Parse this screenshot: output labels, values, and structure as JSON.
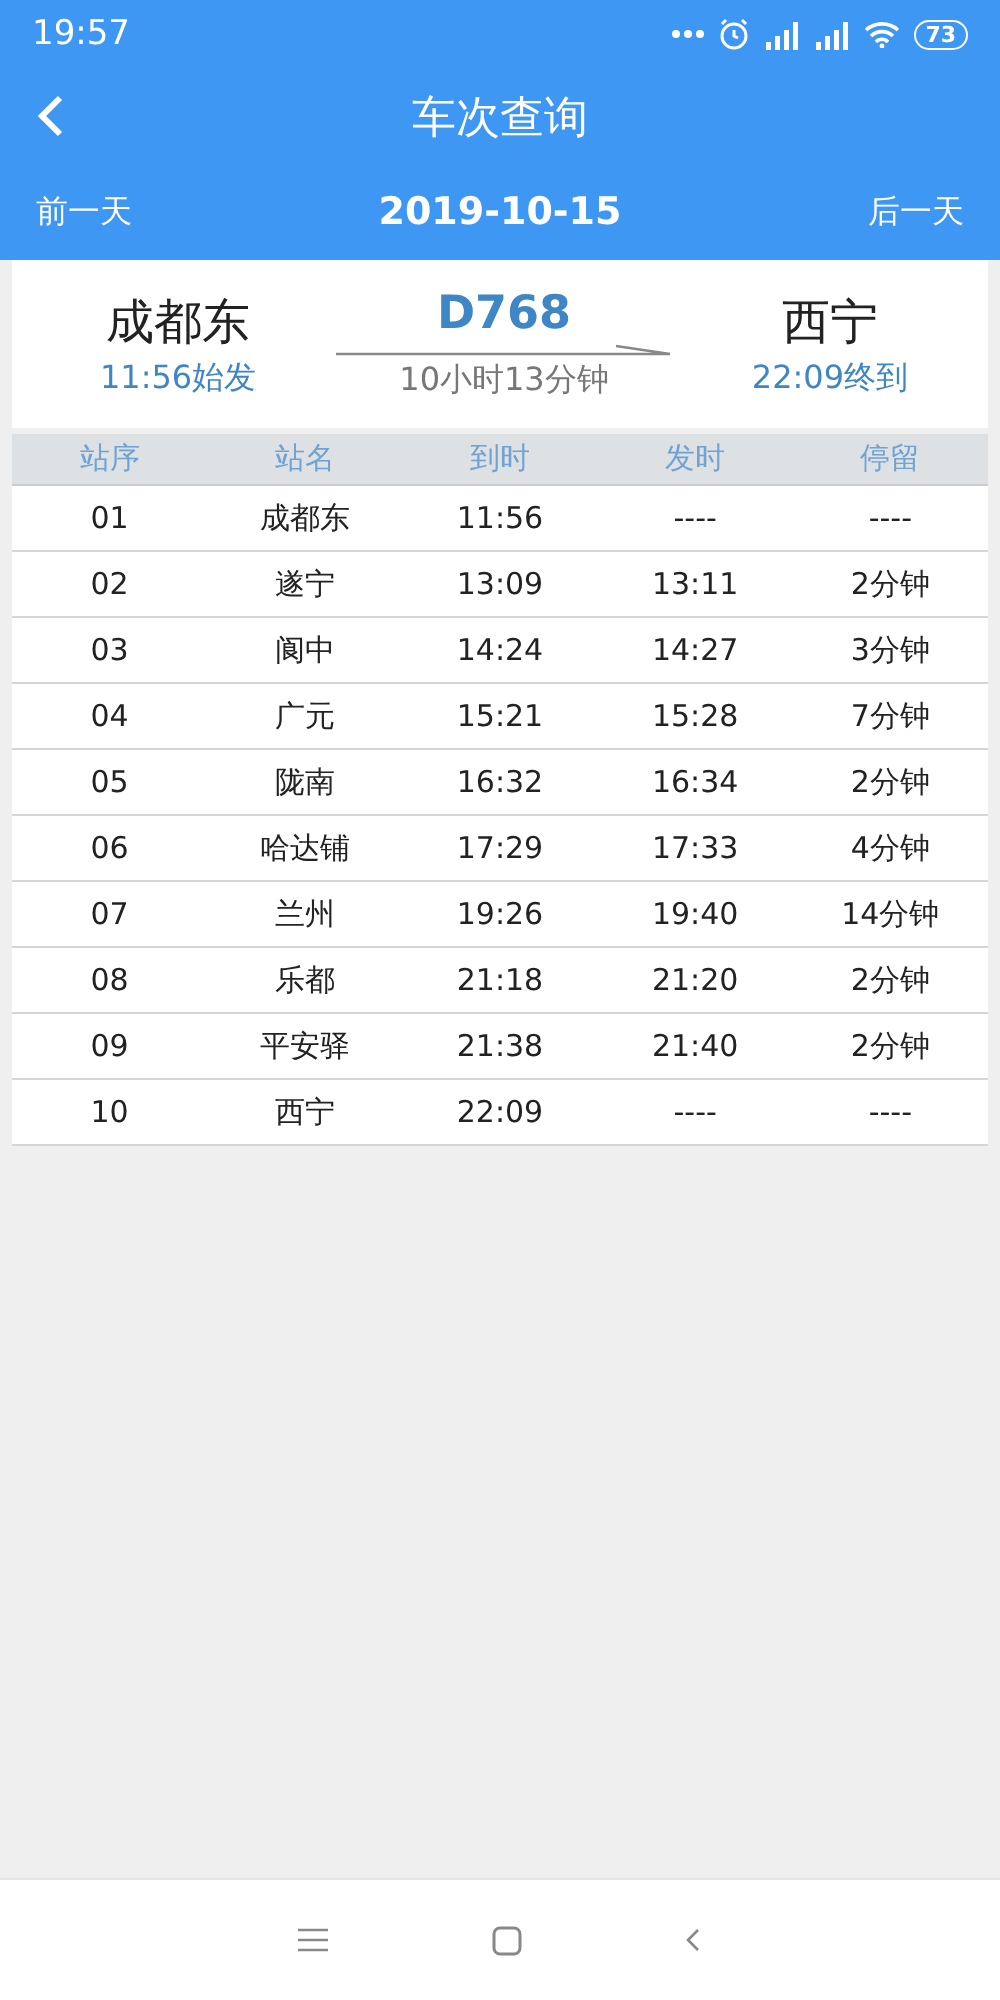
{
  "status_bar": {
    "time": "19:57",
    "battery": "73"
  },
  "header": {
    "title": "车次查询",
    "prev_day": "前一天",
    "date": "2019-10-15",
    "next_day": "后一天"
  },
  "train": {
    "from_station": "成都东",
    "from_time": "11:56始发",
    "number": "D768",
    "duration": "10小时13分钟",
    "to_station": "西宁",
    "to_time": "22:09终到"
  },
  "table": {
    "columns": [
      "站序",
      "站名",
      "到时",
      "发时",
      "停留"
    ],
    "rows": [
      [
        "01",
        "成都东",
        "11:56",
        "----",
        "----"
      ],
      [
        "02",
        "遂宁",
        "13:09",
        "13:11",
        "2分钟"
      ],
      [
        "03",
        "阆中",
        "14:24",
        "14:27",
        "3分钟"
      ],
      [
        "04",
        "广元",
        "15:21",
        "15:28",
        "7分钟"
      ],
      [
        "05",
        "陇南",
        "16:32",
        "16:34",
        "2分钟"
      ],
      [
        "06",
        "哈达铺",
        "17:29",
        "17:33",
        "4分钟"
      ],
      [
        "07",
        "兰州",
        "19:26",
        "19:40",
        "14分钟"
      ],
      [
        "08",
        "乐都",
        "21:18",
        "21:20",
        "2分钟"
      ],
      [
        "09",
        "平安驿",
        "21:38",
        "21:40",
        "2分钟"
      ],
      [
        "10",
        "西宁",
        "22:09",
        "----",
        "----"
      ]
    ]
  }
}
